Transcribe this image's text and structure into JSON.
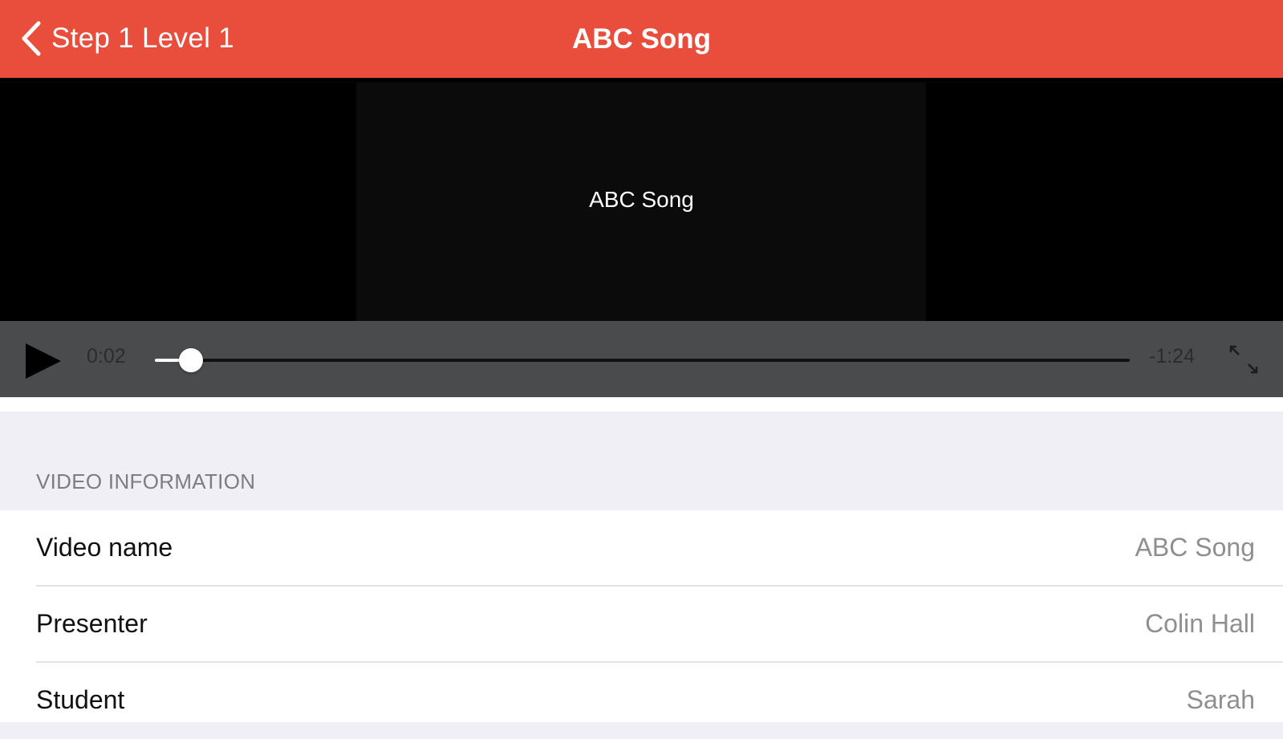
{
  "navbar": {
    "back_label": "Step 1 Level 1",
    "title": "ABC Song",
    "background_color": "#e94e3c",
    "back_icon": "chevron-left-icon"
  },
  "video": {
    "caption": "ABC Song",
    "elapsed": "0:02",
    "remaining": "-1:24",
    "progress": 0.037,
    "play_icon": "play-icon",
    "fullscreen_icon": "fullscreen-icon"
  },
  "info": {
    "section_title": "VIDEO INFORMATION",
    "rows": [
      {
        "label": "Video name",
        "value": "ABC Song"
      },
      {
        "label": "Presenter",
        "value": "Colin Hall"
      },
      {
        "label": "Student",
        "value": "Sarah"
      }
    ]
  }
}
